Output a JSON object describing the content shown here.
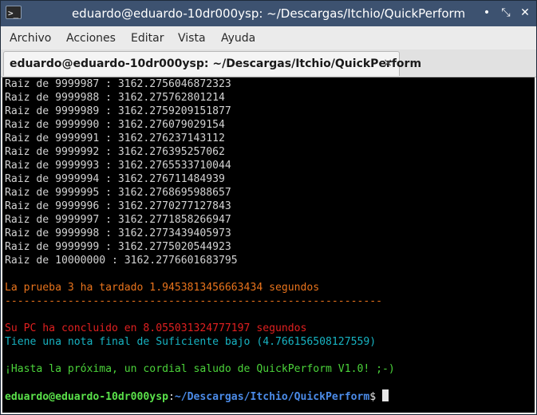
{
  "window": {
    "title": "eduardo@eduardo-10dr000ysp: ~/Descargas/Itchio/QuickPerform",
    "app_icon_glyph": ">_",
    "controls": {
      "minimize": "•",
      "maximize": "⤡",
      "close": "✕"
    }
  },
  "menu": {
    "items": [
      "Archivo",
      "Acciones",
      "Editar",
      "Vista",
      "Ayuda"
    ]
  },
  "tab": {
    "label": "eduardo@eduardo-10dr000ysp: ~/Descargas/Itchio/QuickPerform",
    "close": "×"
  },
  "terminal": {
    "lines": [
      "Raiz de 9999987 : 3162.2756046872323",
      "Raiz de 9999988 : 3162.275762801214",
      "Raiz de 9999989 : 3162.2759209151877",
      "Raiz de 9999990 : 3162.276079029154",
      "Raiz de 9999991 : 3162.276237143112",
      "Raiz de 9999992 : 3162.276395257062",
      "Raiz de 9999993 : 3162.2765533710044",
      "Raiz de 9999994 : 3162.276711484939",
      "Raiz de 9999995 : 3162.2768695988657",
      "Raiz de 9999996 : 3162.2770277127843",
      "Raiz de 9999997 : 3162.2771858266947",
      "Raiz de 9999998 : 3162.2773439405973",
      "Raiz de 9999999 : 3162.2775020544923",
      "Raiz de 10000000 : 3162.2776601683795"
    ],
    "test_time": "La prueba 3 ha tardado 1.9453813456663434 segundos",
    "separator": "------------------------------------------------------------",
    "total_time": "Su PC ha concluido en 8.055031324777197 segundos",
    "final_grade": "Tiene una nota final de Suficiente bajo (4.766156508127559)",
    "farewell": "¡Hasta la próxima, un cordial saludo de QuickPerform V1.0! ;-)",
    "prompt_user": "eduardo@eduardo-10dr000ysp",
    "prompt_sep": ":",
    "prompt_path": "~/Descargas/Itchio/QuickPerform",
    "prompt_symbol": "$ "
  },
  "colors": {
    "titlebar": "#3d5270",
    "terminal_bg": "#000000",
    "orange": "#e8731c",
    "red": "#e02020",
    "cyan": "#17b3c2",
    "green": "#4bd33a",
    "blue": "#4b8be8"
  }
}
